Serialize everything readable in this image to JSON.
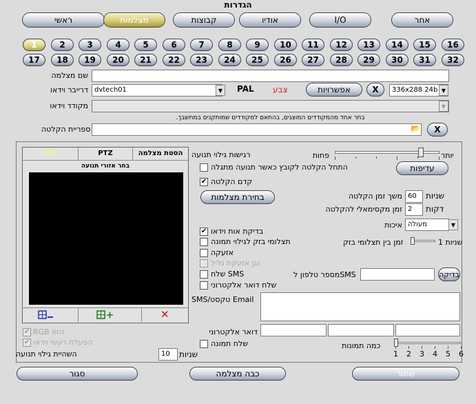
{
  "title": "הגדרות",
  "tabs": [
    {
      "label": "ראשי",
      "active": false
    },
    {
      "label": "מצלמות",
      "active": true
    },
    {
      "label": "קבוצות",
      "active": false
    },
    {
      "label": "אודיו",
      "active": false
    },
    {
      "label": "I/O",
      "active": false
    },
    {
      "label": "אחר",
      "active": false
    }
  ],
  "camera_numbers_row1": [
    "1",
    "2",
    "3",
    "4",
    "5",
    "6",
    "7",
    "8",
    "9",
    "10",
    "11",
    "12",
    "13",
    "14",
    "15",
    "16"
  ],
  "camera_numbers_row2": [
    "17",
    "18",
    "19",
    "20",
    "21",
    "22",
    "23",
    "24",
    "25",
    "26",
    "27",
    "28",
    "29",
    "30",
    "31",
    "32"
  ],
  "selected_camera": "1",
  "form": {
    "camera_name_label": "שם מצלמה",
    "camera_name_value": "",
    "video_driver_label": "דרייבר וידאו",
    "video_driver_value": "dvtech01",
    "standard": "PAL",
    "color_label": "צבע",
    "options_button": "אפשרויות",
    "close_symbol": "X",
    "resolution_value": "336x288 24b",
    "video_encoder_label": "מקודד וידאו",
    "encoder_hint": ".בחר אחד מהמקודדים המוצגים, בהתאם למקודדים שמותקנים במחשבך",
    "recording_folder_label": "ספריית הקלטה"
  },
  "left_panel": {
    "tabs": [
      "MD",
      "PTZ",
      "הסטת מצלמה"
    ],
    "zone_header": "בחר אזורי תנועה",
    "add_zone_icon": "grid-plus-icon",
    "remove_zone_icon": "grid-minus-icon",
    "clear_zones_icon": "close-icon",
    "rgb_label": "RGB הזזו",
    "rgb_checked": true,
    "show_motion_label": "הפעלת רעשי וידאו",
    "show_motion_checked": true,
    "motion_stop_label": "השהיית גילוי תנועה",
    "motion_stop_value": "10",
    "seconds_label": "שניות"
  },
  "motion": {
    "sensitivity_label": "רגישות גילוי תנועה",
    "less_label": "פחות",
    "more_label": "יותר",
    "sensitivity_level": 0.84,
    "start_new_file_label": "התחל הקלטה לקובץ כאשר תנועה מתגלה",
    "start_new_file_checked": false,
    "pre_record_label": "קדם הקלטה",
    "pre_record_checked": true,
    "priority_button": "עדיפות",
    "camera_select_button": "בחירת מצלמות",
    "duration_label": "משך זמן הקלטה",
    "duration_value": "60",
    "duration_unit": "שניות",
    "max_time_label": "זמן מקסימאלי להקלטה",
    "max_time_value": "2",
    "max_time_unit": "דקות",
    "quality_label": "איכות",
    "quality_value": "מעולה",
    "test_interval_label": "זמן בין תצלומי בזק",
    "test_interval_unit": "שניות 1",
    "video_check_label": "בדיקת אות וידאו",
    "video_check_checked": true,
    "snapshot_label": "תצלומי בזק לגילוי תמונה",
    "snapshot_checked": false,
    "alarm_label": "אזעקה",
    "alarm_checked": false,
    "alarm_sound_label": "נגן אזעקת גליל",
    "alarm_sound_checked": false,
    "sms_label": "שלח SMS",
    "sms_checked": false,
    "email_label": "שלח דואר אלקטרוני",
    "email_checked": false,
    "phone_label": "מספר טלפון לSMS",
    "phone_value": "",
    "test_button": "בדיקה",
    "sms_text_label": "SMS/טקסט Email",
    "email_address_label": "דואר אלקטרוני",
    "send_image_label": "שלח תמונה",
    "send_image_checked": false,
    "image_count_label": "כמה תמונות",
    "image_count_ticks": [
      "1",
      "2",
      "3",
      "4",
      "5",
      "6"
    ],
    "image_count_value": 1
  },
  "footer": {
    "close_button": "סגור",
    "disable_camera_button": "כבה מצלמה",
    "save_button": "שמור"
  },
  "colors": {
    "active_tab": "#d6cc7a",
    "color_label": "#d42020",
    "preview": "#000000"
  }
}
